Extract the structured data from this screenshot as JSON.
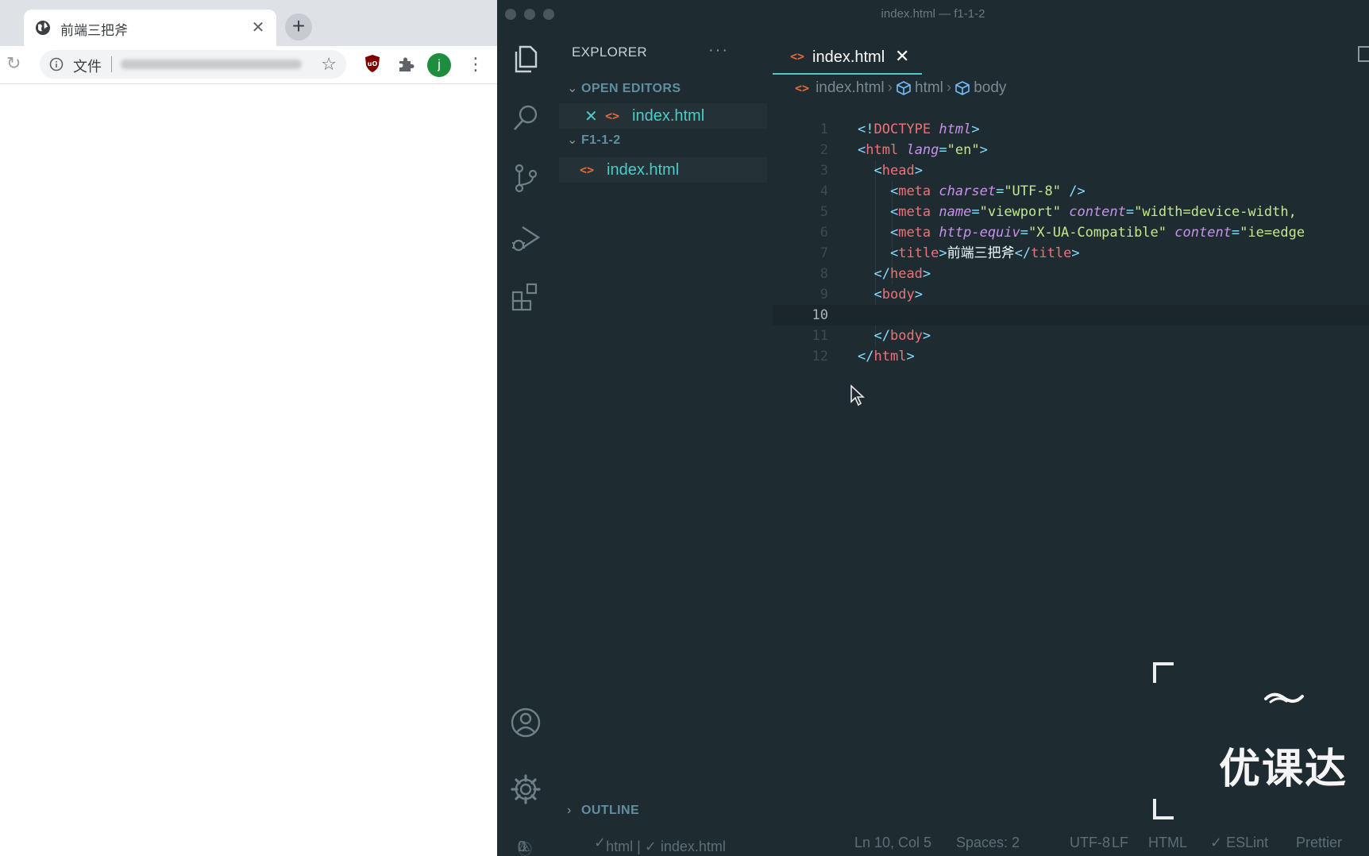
{
  "browser": {
    "tab_title": "前端三把斧",
    "tab_close": "✕",
    "new_tab": "+",
    "address_scheme": "文件",
    "profile_initial": "j"
  },
  "vscode": {
    "window_title": "index.html — f1-1-2",
    "explorer": {
      "title": "EXPLORER",
      "more": "···",
      "open_editors_label": "OPEN EDITORS",
      "open_editor_file": "index.html",
      "folder_label": "F1-1-2",
      "folder_file": "index.html",
      "outline_label": "OUTLINE"
    },
    "tab": {
      "label": "index.html",
      "close": "✕"
    },
    "breadcrumb": [
      "index.html",
      "html",
      "body"
    ],
    "line_numbers": [
      "1",
      "2",
      "3",
      "4",
      "5",
      "6",
      "7",
      "8",
      "9",
      "10",
      "11",
      "12"
    ],
    "status": {
      "errors": "0",
      "warnings": "0",
      "validation": "html | ✓ index.html",
      "position": "Ln 10, Col 5",
      "spaces": "Spaces: 2",
      "encoding": "UTF-8",
      "eol": "LF",
      "language": "HTML",
      "eslint": "✓ ESLint",
      "prettier": "Prettier"
    }
  },
  "code_text": {
    "doctype": "DOCTYPE",
    "html_kw": "html",
    "lang_attr": "lang",
    "lang_val": "\"en\"",
    "charset_attr": "charset",
    "charset_val": "\"UTF-8\"",
    "name_attr": "name",
    "name_val": "\"viewport\"",
    "content_attr": "content",
    "content_val_1": "\"width=device-width,",
    "http_attr": "http-equiv",
    "http_val": "\"X-UA-Compatible\"",
    "content_val_2": "\"ie=edge",
    "title_text": "前端三把斧"
  },
  "watermark": {
    "text": "优课达"
  },
  "colors": {
    "editor_bg": "#1e2b31",
    "accent": "#4ecbc8",
    "tag": "#f07178",
    "attr": "#c792ea",
    "string": "#c3e88d",
    "punctuation": "#89ddff"
  },
  "icons": {
    "activity_bar": [
      "files-icon",
      "search-icon",
      "source-control-icon",
      "run-debug-icon",
      "extensions-icon",
      "account-icon",
      "settings-gear-icon"
    ]
  }
}
